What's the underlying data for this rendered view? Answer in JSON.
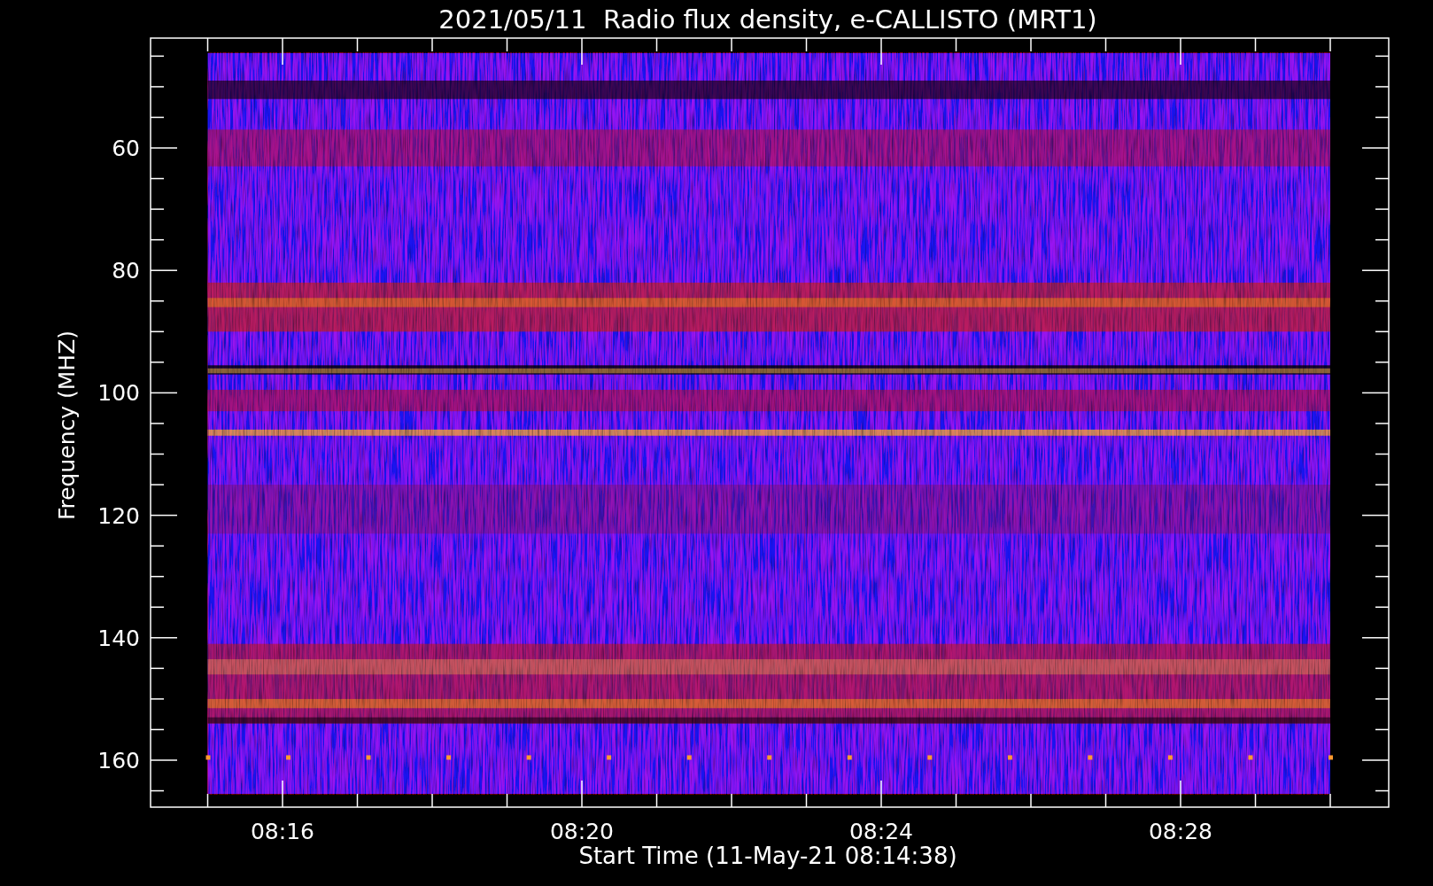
{
  "title": "2021/05/11  Radio flux density, e-CALLISTO (MRT1)",
  "y_axis": {
    "label": "Frequency (MHZ)",
    "ticks": [
      "60",
      "80",
      "100",
      "120",
      "140",
      "160"
    ]
  },
  "x_axis": {
    "label": "Start Time (11-May-21 08:14:38)",
    "ticks": [
      "08:16",
      "08:20",
      "08:24",
      "08:28"
    ]
  }
}
